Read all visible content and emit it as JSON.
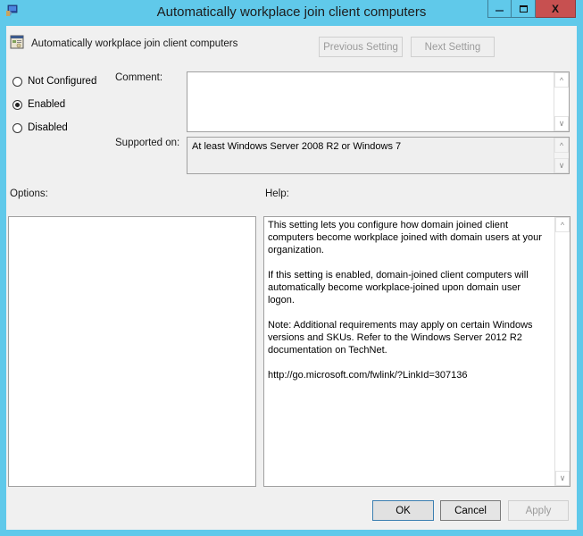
{
  "window": {
    "title": "Automatically workplace join client computers",
    "icon": "group-policy-icon",
    "controls": {
      "minimize": "minimize-icon",
      "maximize": "maximize-icon",
      "close": "close-icon"
    }
  },
  "header": {
    "policy_name": "Automatically workplace join client computers",
    "policy_icon": "policy-setting-icon",
    "previous_label": "Previous Setting",
    "next_label": "Next Setting"
  },
  "state": {
    "options": [
      {
        "label": "Not Configured",
        "selected": false
      },
      {
        "label": "Enabled",
        "selected": true
      },
      {
        "label": "Disabled",
        "selected": false
      }
    ]
  },
  "comment": {
    "label": "Comment:",
    "value": ""
  },
  "supported": {
    "label": "Supported on:",
    "value": "At least Windows Server 2008 R2 or Windows 7"
  },
  "options_panel": {
    "label": "Options:"
  },
  "help_panel": {
    "label": "Help:",
    "paragraphs": [
      "This setting lets you configure how domain joined client computers become workplace joined with domain users at your organization.",
      "If this setting is enabled, domain-joined client computers will automatically become workplace-joined upon domain user logon.",
      "Note: Additional requirements may apply on certain Windows versions and SKUs.  Refer to the Windows Server 2012 R2 documentation on TechNet.",
      "http://go.microsoft.com/fwlink/?LinkId=307136"
    ]
  },
  "footer": {
    "ok_label": "OK",
    "cancel_label": "Cancel",
    "apply_label": "Apply"
  }
}
